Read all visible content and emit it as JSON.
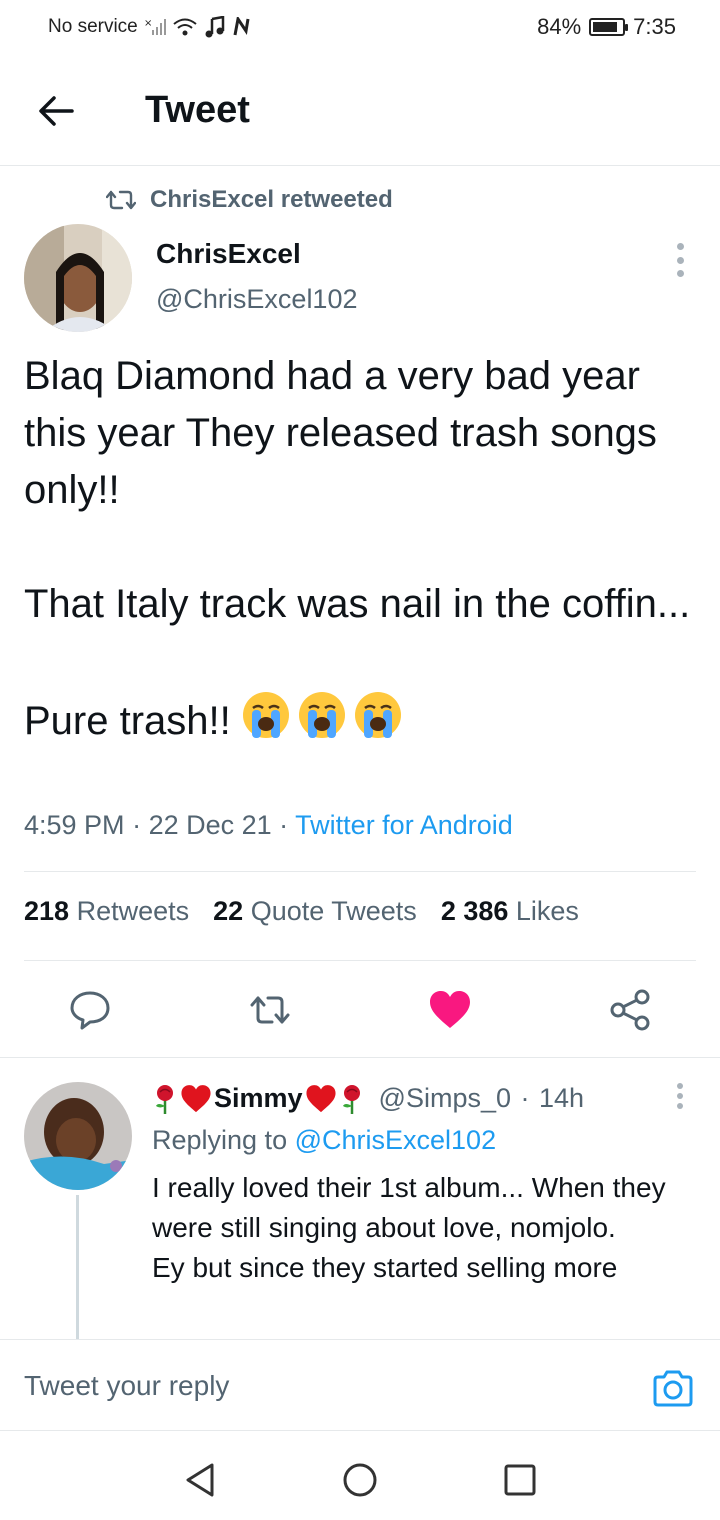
{
  "status_bar": {
    "carrier": "No service",
    "battery": "84%",
    "battery_level": 0.84,
    "time": "7:35"
  },
  "header": {
    "title": "Tweet"
  },
  "retweet_banner": {
    "text": "ChrisExcel retweeted"
  },
  "tweet": {
    "author_name": "ChrisExcel",
    "author_handle": "@ChrisExcel102",
    "text": "Blaq Diamond had a very bad year this year They released trash songs only!!\n\nThat Italy track was nail in the coffin...\n\nPure trash!!",
    "emoji": [
      "loudly-crying-face",
      "loudly-crying-face",
      "loudly-crying-face"
    ],
    "time": "4:59 PM",
    "date": "22 Dec 21",
    "source": "Twitter for Android",
    "retweets_count": "218",
    "retweets_label": "Retweets",
    "quotes_count": "22",
    "quotes_label": "Quote Tweets",
    "likes_count": "2 386",
    "likes_label": "Likes",
    "liked": true
  },
  "actions": {
    "reply_icon": "comment-icon",
    "retweet_icon": "retweet-icon",
    "like_icon": "heart-icon",
    "share_icon": "share-icon"
  },
  "reply": {
    "name": "Simmy",
    "handle": "@Simps_0",
    "time": "14h",
    "replying_prefix": "Replying to",
    "replying_to": "@ChrisExcel102",
    "text": "I really loved their 1st album... When they were still singing about love, nomjolo.\nEy but since they started selling more"
  },
  "compose": {
    "placeholder": "Tweet your reply"
  },
  "colors": {
    "accent": "#1d9bf0",
    "like": "#f91880",
    "secondary_text": "#536471"
  }
}
